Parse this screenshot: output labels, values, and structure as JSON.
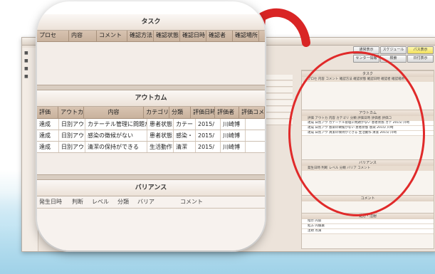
{
  "background": {
    "buttons": [
      "通常表示",
      "スケジュール",
      "パス表示",
      "センター情報",
      "検索",
      "日付表示"
    ],
    "task": {
      "title": "タスク",
      "columns": "プロセ 内容 コメント 確認方法 確認状態 確認日時 確認者 確認場所"
    },
    "outcome": {
      "title": "アウトカム",
      "columns": "評価 アウトカ 内容 カテゴリ 分類 評価日時 評価者 評価コ",
      "rows": [
        "達成 日別アウ カテーテル管理に問題がない 患者状態 カテ 2015/ 川崎",
        "達成 日別アウ 感染の徴候がない 患者状態 感染 2015/ 川崎",
        "達成 日別アウ 清潔の保持ができる 生活動作 清潔 2015/ 川崎"
      ]
    },
    "variance": {
      "title": "バリアンス",
      "columns": "発生日時 判断 レベル 分類 バリア コメント"
    },
    "comment": {
      "title": "コメント"
    },
    "medication": {
      "title": "処方・注射",
      "rows": [
        "指示 内容",
        "処方 内服薬",
        "注射 点滴"
      ]
    }
  },
  "magnified": {
    "task": {
      "title": "タスク",
      "columns": [
        "プロセ",
        "内容",
        "コメント",
        "確認方法",
        "確認状態",
        "確認日時",
        "確認者",
        "確認場所"
      ]
    },
    "outcome": {
      "title": "アウトカム",
      "columns": [
        "評価",
        "アウトカ",
        "内容",
        "カテゴリ",
        "分類",
        "評価日時",
        "評価者",
        "評価コメ"
      ],
      "rows": [
        [
          "達成",
          "日別アウ",
          "カテーテル管理に問題がない",
          "患者状態",
          "カテー",
          "2015/",
          "川崎博"
        ],
        [
          "達成",
          "日別アウ",
          "感染の徴候がない",
          "患者状態",
          "感染・",
          "2015/",
          "川崎博"
        ],
        [
          "達成",
          "日別アウ",
          "清潔の保持ができる",
          "生活動作",
          "清潔",
          "2015/",
          "川崎博"
        ]
      ]
    },
    "variance": {
      "title": "バリアンス",
      "columns": [
        "発生日時",
        "判断",
        "レベル",
        "分類",
        "バリア",
        "コメント"
      ]
    }
  },
  "colors": {
    "highlight_circle": "#e02a2a",
    "header_bg": "#c9b29d"
  }
}
